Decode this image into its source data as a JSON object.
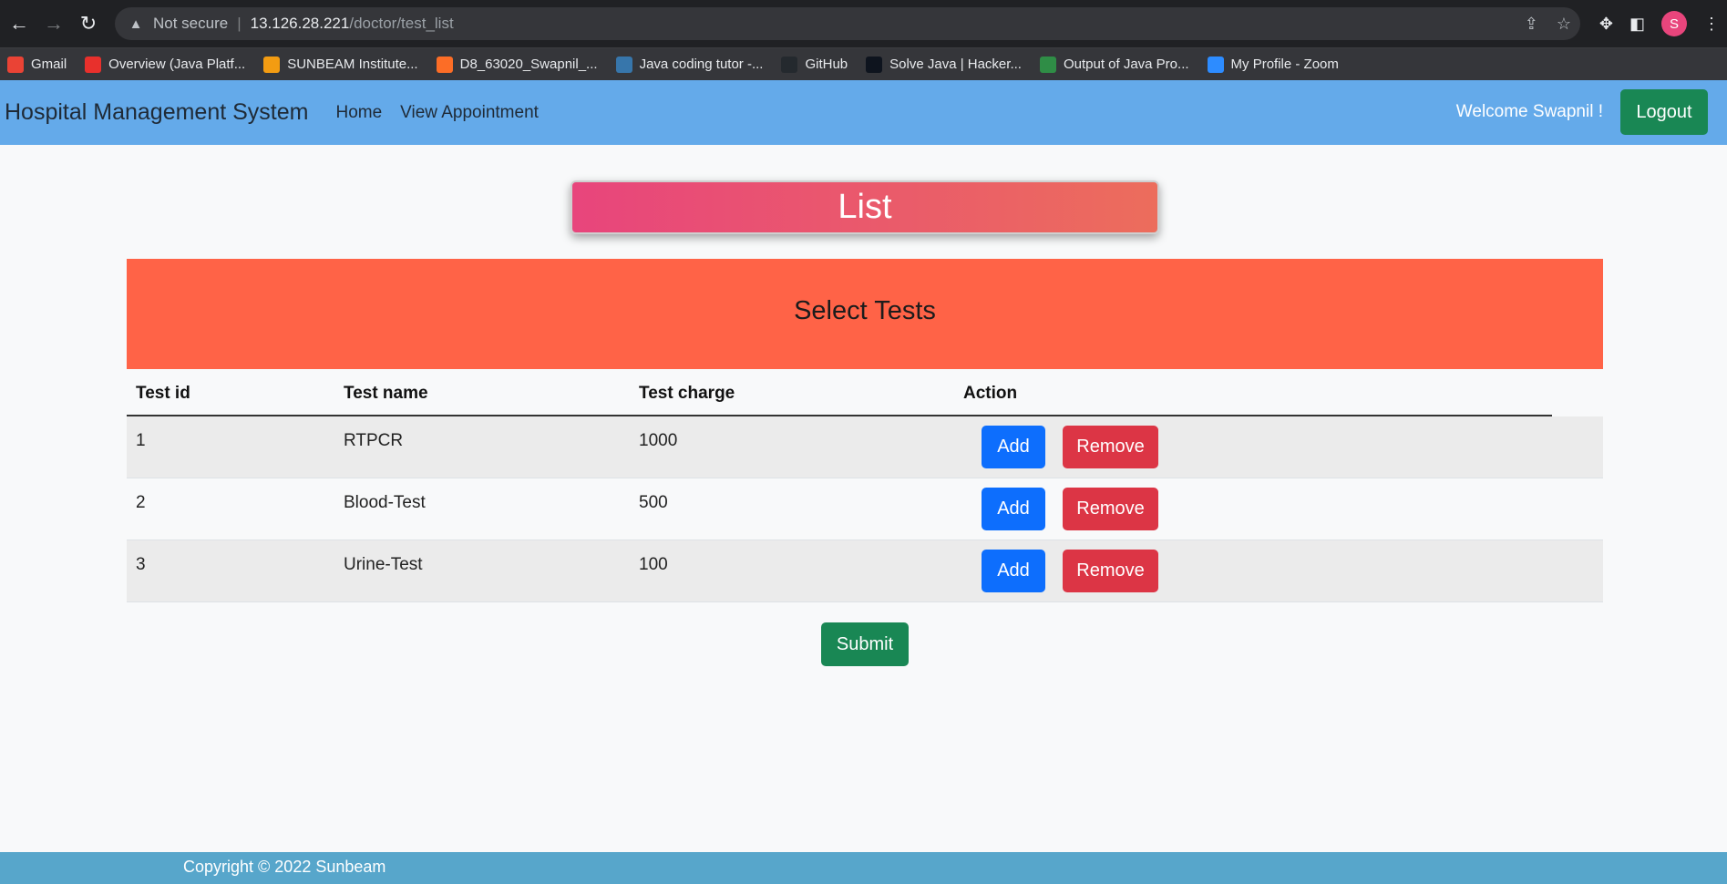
{
  "browser": {
    "not_secure": "Not secure",
    "url_host": "13.126.28.221",
    "url_path": "/doctor/test_list",
    "profile_initial": "S",
    "bookmarks": [
      {
        "label": "Gmail",
        "icon": "gmail-icon",
        "color": "#ea4335"
      },
      {
        "label": "Overview (Java Platf...",
        "icon": "oracle-icon",
        "color": "#e8302c"
      },
      {
        "label": "SUNBEAM Institute...",
        "icon": "sunbeam-icon",
        "color": "#f39c12"
      },
      {
        "label": "D8_63020_Swapnil_...",
        "icon": "gitlab-icon",
        "color": "#fc6d26"
      },
      {
        "label": "Java coding tutor -...",
        "icon": "python-icon",
        "color": "#3776ab"
      },
      {
        "label": "GitHub",
        "icon": "github-icon",
        "color": "#24292e"
      },
      {
        "label": "Solve Java | Hacker...",
        "icon": "hackerrank-icon",
        "color": "#0e141e"
      },
      {
        "label": "Output of Java Pro...",
        "icon": "geeksforgeeks-icon",
        "color": "#2f8d46"
      },
      {
        "label": "My Profile - Zoom",
        "icon": "zoom-icon",
        "color": "#2d8cff"
      }
    ]
  },
  "navbar": {
    "brand": "Hospital Management System",
    "links": [
      "Home",
      "View Appointment"
    ],
    "welcome": "Welcome Swapnil !",
    "logout": "Logout"
  },
  "page": {
    "banner": "List",
    "panel_title": "Select Tests",
    "columns": [
      "Test id",
      "Test name",
      "Test charge",
      "Action"
    ],
    "rows": [
      {
        "id": "1",
        "name": "RTPCR",
        "charge": "1000"
      },
      {
        "id": "2",
        "name": "Blood-Test",
        "charge": "500"
      },
      {
        "id": "3",
        "name": "Urine-Test",
        "charge": "100"
      }
    ],
    "add_label": "Add",
    "remove_label": "Remove",
    "submit_label": "Submit"
  },
  "footer": {
    "copyright": "Copyright © 2022 Sunbeam"
  },
  "colors": {
    "navbar": "#64aaea",
    "panel": "#ff6347",
    "add": "#0d6efd",
    "remove": "#dc3545",
    "success": "#198754",
    "footer": "#57a6cb"
  }
}
